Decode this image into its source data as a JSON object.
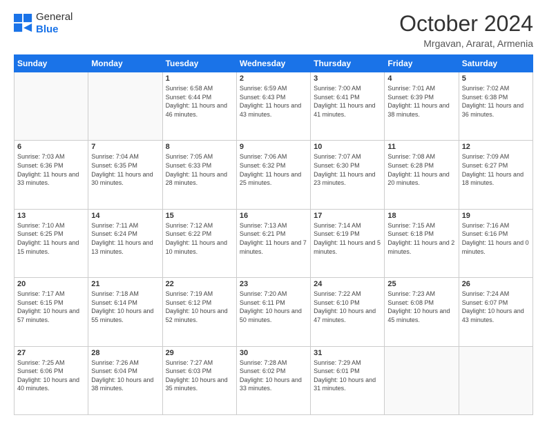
{
  "header": {
    "logo_general": "General",
    "logo_blue": "Blue",
    "month_title": "October 2024",
    "location": "Mrgavan, Ararat, Armenia"
  },
  "calendar": {
    "days_of_week": [
      "Sunday",
      "Monday",
      "Tuesday",
      "Wednesday",
      "Thursday",
      "Friday",
      "Saturday"
    ],
    "weeks": [
      [
        {
          "day": "",
          "info": ""
        },
        {
          "day": "",
          "info": ""
        },
        {
          "day": "1",
          "info": "Sunrise: 6:58 AM\nSunset: 6:44 PM\nDaylight: 11 hours and 46 minutes."
        },
        {
          "day": "2",
          "info": "Sunrise: 6:59 AM\nSunset: 6:43 PM\nDaylight: 11 hours and 43 minutes."
        },
        {
          "day": "3",
          "info": "Sunrise: 7:00 AM\nSunset: 6:41 PM\nDaylight: 11 hours and 41 minutes."
        },
        {
          "day": "4",
          "info": "Sunrise: 7:01 AM\nSunset: 6:39 PM\nDaylight: 11 hours and 38 minutes."
        },
        {
          "day": "5",
          "info": "Sunrise: 7:02 AM\nSunset: 6:38 PM\nDaylight: 11 hours and 36 minutes."
        }
      ],
      [
        {
          "day": "6",
          "info": "Sunrise: 7:03 AM\nSunset: 6:36 PM\nDaylight: 11 hours and 33 minutes."
        },
        {
          "day": "7",
          "info": "Sunrise: 7:04 AM\nSunset: 6:35 PM\nDaylight: 11 hours and 30 minutes."
        },
        {
          "day": "8",
          "info": "Sunrise: 7:05 AM\nSunset: 6:33 PM\nDaylight: 11 hours and 28 minutes."
        },
        {
          "day": "9",
          "info": "Sunrise: 7:06 AM\nSunset: 6:32 PM\nDaylight: 11 hours and 25 minutes."
        },
        {
          "day": "10",
          "info": "Sunrise: 7:07 AM\nSunset: 6:30 PM\nDaylight: 11 hours and 23 minutes."
        },
        {
          "day": "11",
          "info": "Sunrise: 7:08 AM\nSunset: 6:28 PM\nDaylight: 11 hours and 20 minutes."
        },
        {
          "day": "12",
          "info": "Sunrise: 7:09 AM\nSunset: 6:27 PM\nDaylight: 11 hours and 18 minutes."
        }
      ],
      [
        {
          "day": "13",
          "info": "Sunrise: 7:10 AM\nSunset: 6:25 PM\nDaylight: 11 hours and 15 minutes."
        },
        {
          "day": "14",
          "info": "Sunrise: 7:11 AM\nSunset: 6:24 PM\nDaylight: 11 hours and 13 minutes."
        },
        {
          "day": "15",
          "info": "Sunrise: 7:12 AM\nSunset: 6:22 PM\nDaylight: 11 hours and 10 minutes."
        },
        {
          "day": "16",
          "info": "Sunrise: 7:13 AM\nSunset: 6:21 PM\nDaylight: 11 hours and 7 minutes."
        },
        {
          "day": "17",
          "info": "Sunrise: 7:14 AM\nSunset: 6:19 PM\nDaylight: 11 hours and 5 minutes."
        },
        {
          "day": "18",
          "info": "Sunrise: 7:15 AM\nSunset: 6:18 PM\nDaylight: 11 hours and 2 minutes."
        },
        {
          "day": "19",
          "info": "Sunrise: 7:16 AM\nSunset: 6:16 PM\nDaylight: 11 hours and 0 minutes."
        }
      ],
      [
        {
          "day": "20",
          "info": "Sunrise: 7:17 AM\nSunset: 6:15 PM\nDaylight: 10 hours and 57 minutes."
        },
        {
          "day": "21",
          "info": "Sunrise: 7:18 AM\nSunset: 6:14 PM\nDaylight: 10 hours and 55 minutes."
        },
        {
          "day": "22",
          "info": "Sunrise: 7:19 AM\nSunset: 6:12 PM\nDaylight: 10 hours and 52 minutes."
        },
        {
          "day": "23",
          "info": "Sunrise: 7:20 AM\nSunset: 6:11 PM\nDaylight: 10 hours and 50 minutes."
        },
        {
          "day": "24",
          "info": "Sunrise: 7:22 AM\nSunset: 6:10 PM\nDaylight: 10 hours and 47 minutes."
        },
        {
          "day": "25",
          "info": "Sunrise: 7:23 AM\nSunset: 6:08 PM\nDaylight: 10 hours and 45 minutes."
        },
        {
          "day": "26",
          "info": "Sunrise: 7:24 AM\nSunset: 6:07 PM\nDaylight: 10 hours and 43 minutes."
        }
      ],
      [
        {
          "day": "27",
          "info": "Sunrise: 7:25 AM\nSunset: 6:06 PM\nDaylight: 10 hours and 40 minutes."
        },
        {
          "day": "28",
          "info": "Sunrise: 7:26 AM\nSunset: 6:04 PM\nDaylight: 10 hours and 38 minutes."
        },
        {
          "day": "29",
          "info": "Sunrise: 7:27 AM\nSunset: 6:03 PM\nDaylight: 10 hours and 35 minutes."
        },
        {
          "day": "30",
          "info": "Sunrise: 7:28 AM\nSunset: 6:02 PM\nDaylight: 10 hours and 33 minutes."
        },
        {
          "day": "31",
          "info": "Sunrise: 7:29 AM\nSunset: 6:01 PM\nDaylight: 10 hours and 31 minutes."
        },
        {
          "day": "",
          "info": ""
        },
        {
          "day": "",
          "info": ""
        }
      ]
    ]
  }
}
